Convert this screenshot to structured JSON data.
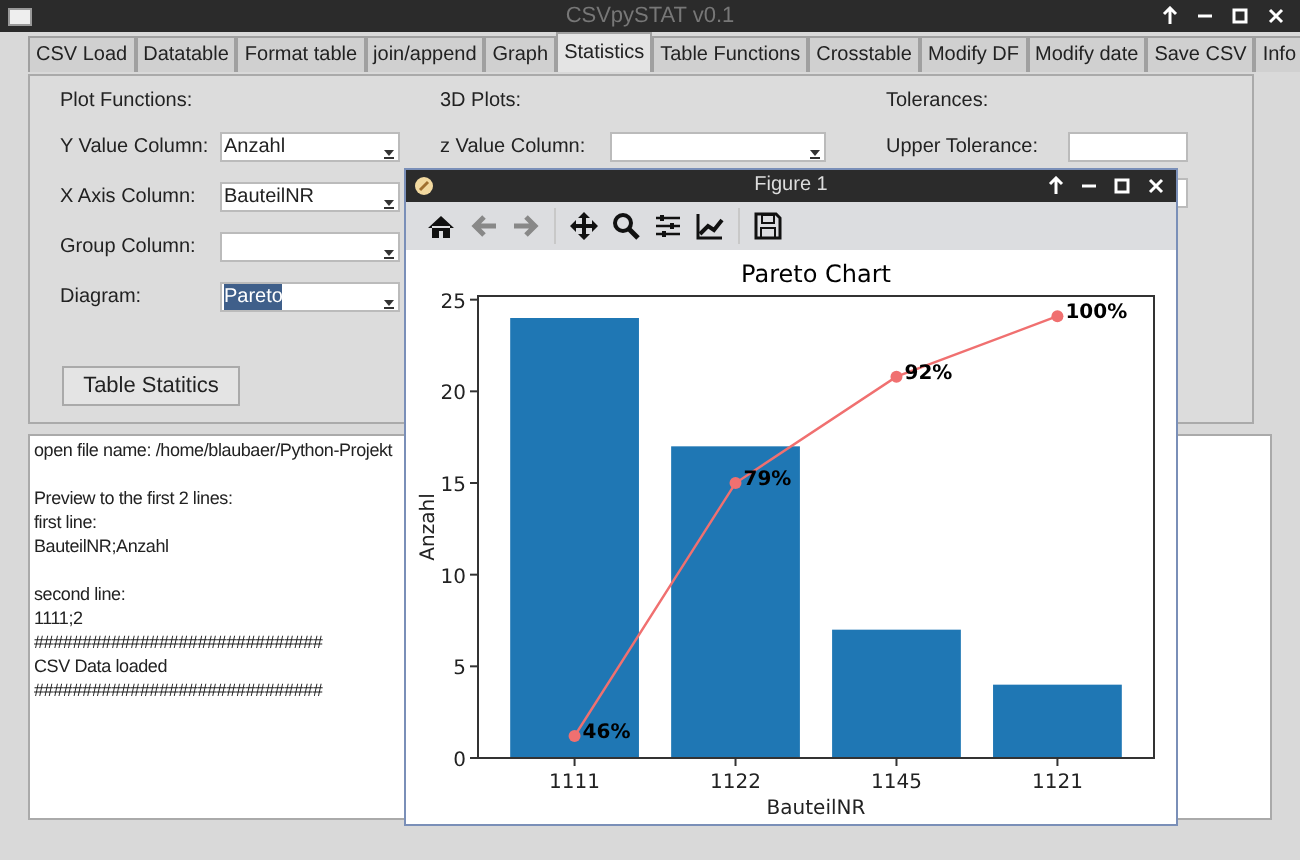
{
  "window": {
    "title": "CSVpySTAT v0.1"
  },
  "tabs": [
    {
      "label": "CSV Load",
      "selected": false
    },
    {
      "label": "Datatable",
      "selected": false
    },
    {
      "label": "Format table",
      "selected": false
    },
    {
      "label": "join/append",
      "selected": false
    },
    {
      "label": "Graph",
      "selected": false
    },
    {
      "label": "Statistics",
      "selected": true
    },
    {
      "label": "Table Functions",
      "selected": false
    },
    {
      "label": "Crosstable",
      "selected": false
    },
    {
      "label": "Modify DF",
      "selected": false
    },
    {
      "label": "Modify date",
      "selected": false
    },
    {
      "label": "Save CSV",
      "selected": false
    },
    {
      "label": "Info",
      "selected": false
    }
  ],
  "plot_functions": {
    "heading": "Plot Functions:",
    "fields": [
      {
        "label": "Y Value Column:",
        "value": "Anzahl",
        "highlighted": false
      },
      {
        "label": "X Axis Column:",
        "value": "BauteilNR",
        "highlighted": false
      },
      {
        "label": "Group Column:",
        "highlighted": false
      },
      {
        "label": "Diagram:",
        "value": "Pareto",
        "highlighted": true
      }
    ],
    "button": "Table Statitics"
  },
  "plots_3d": {
    "heading": "3D Plots:",
    "fields": [
      {
        "label": "z Value Column:"
      }
    ]
  },
  "tolerances": {
    "heading": "Tolerances:",
    "fields": [
      {
        "kind": "entry",
        "label": "Upper Tolerance:"
      },
      {
        "kind": "entry"
      }
    ]
  },
  "log": {
    "paragraphs": [
      [
        "open file name: /home/blaubaer/Python-Projekt"
      ],
      [
        "Preview to the first 2 lines:",
        "first line:",
        "BauteilNR;Anzahl"
      ],
      [
        "second line:",
        "1111;2",
        "##############################",
        "CSV Data loaded",
        "##############################"
      ]
    ]
  },
  "figure": {
    "title": "Figure 1",
    "chart_data": {
      "type": "bar",
      "title": "Pareto Chart",
      "xlabel": "BauteilNR",
      "ylabel": "Anzahl",
      "categories": [
        "1111",
        "1122",
        "1145",
        "1121"
      ],
      "series": [
        {
          "type": "bar",
          "color": "#1f77b4",
          "values": [
            24,
            17,
            7,
            4
          ]
        },
        {
          "type": "line",
          "marker": "o",
          "color": "#f07070",
          "values": [
            1.2,
            15,
            20.8,
            24.1
          ]
        }
      ],
      "ylim": [
        0,
        25.2
      ],
      "yticks": [
        0,
        5,
        10,
        15,
        20,
        25
      ],
      "annotations": [
        {
          "x": "1111",
          "y": 1.2,
          "text": "46%"
        },
        {
          "x": "1122",
          "y": 15,
          "text": "79%"
        },
        {
          "x": "1145",
          "y": 20.8,
          "text": "92%"
        },
        {
          "x": "1121",
          "y": 24.1,
          "text": "100%"
        }
      ]
    }
  }
}
